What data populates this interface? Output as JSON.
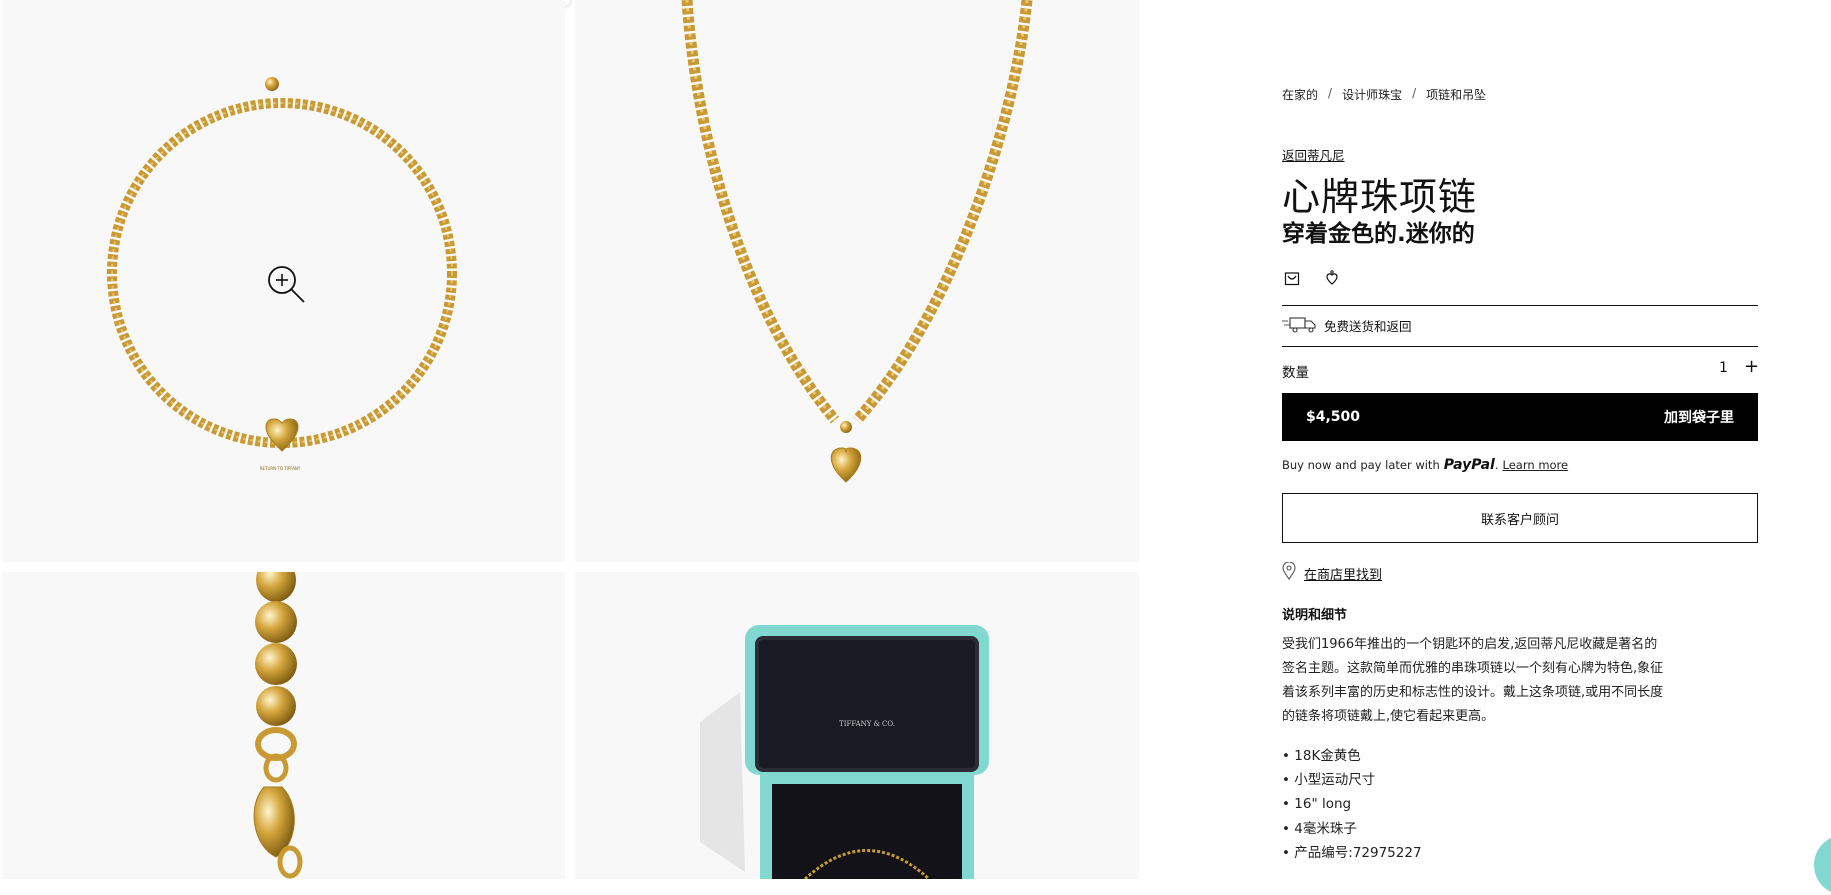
{
  "breadcrumb": [
    "在家的",
    "设计师珠宝",
    "项链和吊坠"
  ],
  "breadcrumb_separator": "/",
  "back_link": "返回蒂凡尼",
  "product": {
    "title": "心牌珠项链",
    "subtitle": "穿着金色的.迷你的"
  },
  "icons": [
    "shopping-bag-icon",
    "heart-tag-icon",
    "delivery-truck-icon",
    "zoom-icon",
    "location-pin-icon"
  ],
  "shipping_text": "免费送货和返回",
  "quantity": {
    "label": "数量",
    "value": "1",
    "plus": "+"
  },
  "buy_button": {
    "price": "$4,500",
    "label": "加到袋子里"
  },
  "paypal": {
    "text": "Buy now and pay later with",
    "logo": "PayPal",
    "suffix": ".",
    "learn_more": "Learn more"
  },
  "contact_button": "联系客户顾问",
  "store_link": "在商店里找到",
  "description": {
    "heading": "说明和细节",
    "body": "受我们1966年推出的一个钥匙环的启发,返回蒂凡尼收藏是著名的签名主题。这款简单而优雅的串珠项链以一个刻有心牌为特色,象征着该系列丰富的历史和标志性的设计。戴上这条项链,或用不同长度的链条将项链戴上,使它看起来更高。"
  },
  "specs": [
    "18K金黄色",
    "小型运动尺寸",
    "16\" long",
    "4毫米珠子",
    "产品编号:72975227"
  ],
  "box_brand": "TIFFANY & CO.",
  "tag_text": "RETURN TO TIFFANY",
  "colors": {
    "gold": "#d4a53c",
    "tiffany_blue": "#81d8d0",
    "black": "#000000",
    "tile_bg": "#f8f8f8"
  }
}
